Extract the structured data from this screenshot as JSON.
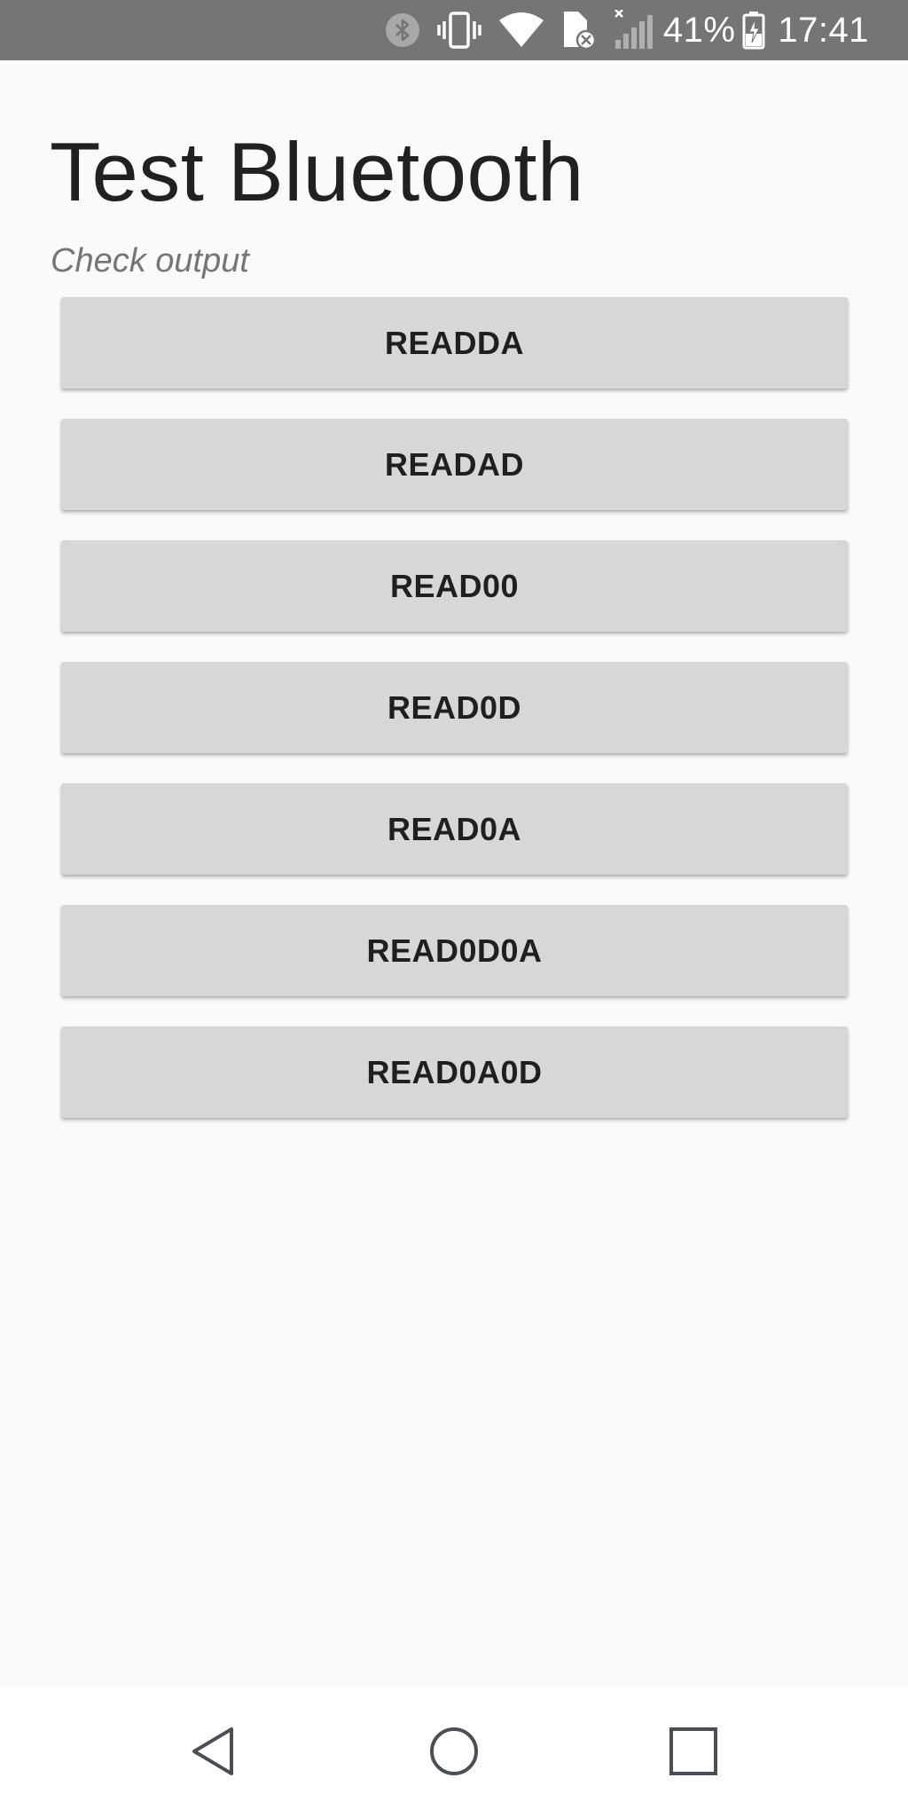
{
  "status_bar": {
    "icons": [
      "bluetooth-icon",
      "vibrate-icon",
      "wifi-icon",
      "no-sim-icon",
      "signal-icon",
      "battery-charging-icon"
    ],
    "battery_percent": "41%",
    "time": "17:41",
    "background_color": "#757575"
  },
  "main": {
    "title": "Test Bluetooth",
    "subtitle": "Check output",
    "buttons": [
      {
        "label": "READDA"
      },
      {
        "label": "READAD"
      },
      {
        "label": "READ00"
      },
      {
        "label": "READ0D"
      },
      {
        "label": "READ0A"
      },
      {
        "label": "READ0D0A"
      },
      {
        "label": "READ0A0D"
      }
    ],
    "button_color": "#d6d7d7"
  },
  "nav_bar": {
    "icons": [
      "back-icon",
      "home-icon",
      "recents-icon"
    ]
  }
}
